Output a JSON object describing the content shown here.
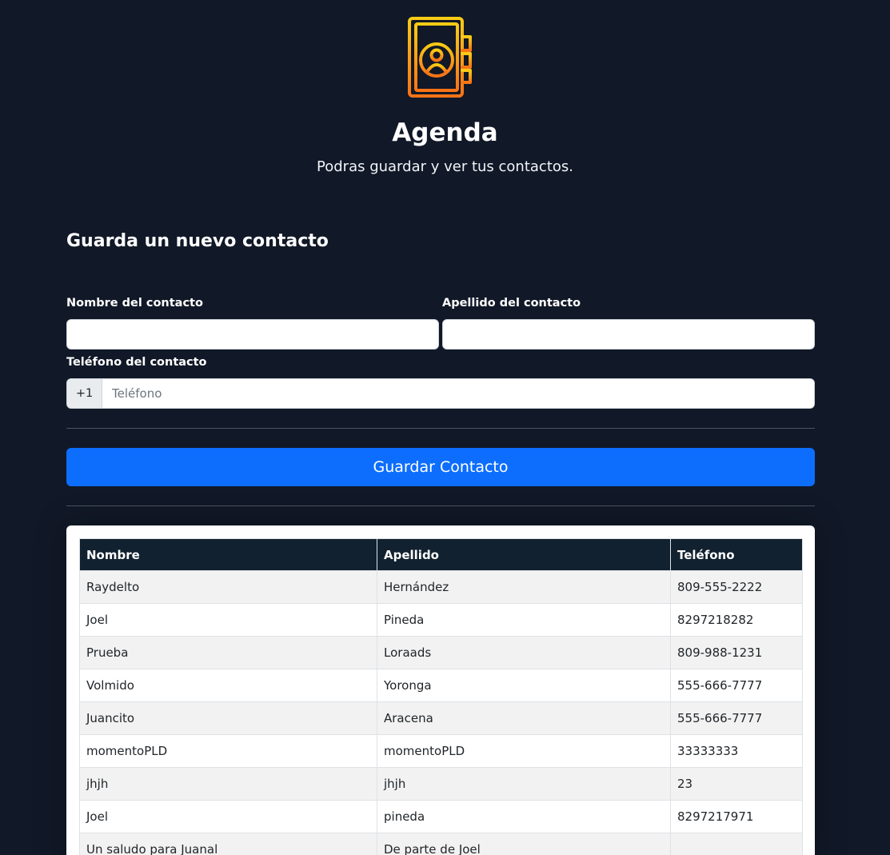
{
  "header": {
    "logo_icon": "contact-book-icon",
    "title": "Agenda",
    "subtitle": "Podras guardar y ver tus contactos."
  },
  "form": {
    "title": "Guarda un nuevo contacto",
    "first_name_label": "Nombre del contacto",
    "first_name_value": "",
    "last_name_label": "Apellido del contacto",
    "last_name_value": "",
    "phone_label": "Teléfono del contacto",
    "phone_prefix": "+1",
    "phone_placeholder": "Teléfono",
    "phone_value": "",
    "submit_label": "Guardar Contacto"
  },
  "table": {
    "columns": [
      "Nombre",
      "Apellido",
      "Teléfono"
    ],
    "rows": [
      [
        "Raydelto",
        "Hernández",
        "809-555-2222"
      ],
      [
        "Joel",
        "Pineda",
        "8297218282"
      ],
      [
        "Prueba",
        "Loraads",
        "809-988-1231"
      ],
      [
        "Volmido",
        "Yoronga",
        "555-666-7777"
      ],
      [
        "Juancito",
        "Aracena",
        "555-666-7777"
      ],
      [
        "momentoPLD",
        "momentoPLD",
        "33333333"
      ],
      [
        "jhjh",
        "jhjh",
        "23"
      ],
      [
        "Joel",
        "pineda",
        "8297217971"
      ],
      [
        "Un saludo para Juanal",
        "De parte de Joel",
        ""
      ]
    ]
  },
  "colors": {
    "background": "#111827",
    "primary": "#0d6efd",
    "table_header": "#11212f",
    "logo_gradient_top": "#facc15",
    "logo_gradient_bottom": "#f97316"
  }
}
